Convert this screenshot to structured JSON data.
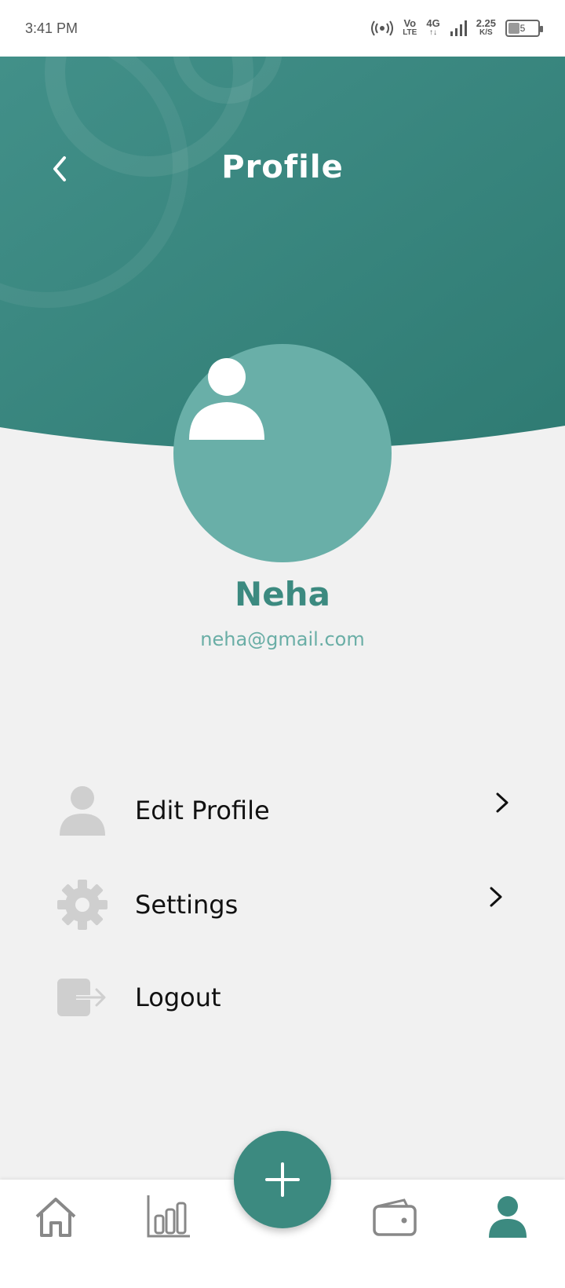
{
  "status_bar": {
    "time": "3:41 PM",
    "network_top": "Vo",
    "network_bottom": "LTE",
    "gen": "4G",
    "speed_value": "2.25",
    "speed_unit": "K/S",
    "battery": "5"
  },
  "header": {
    "title": "Profile",
    "back_icon": "chevron-left-icon",
    "color": "#3c8a80"
  },
  "profile": {
    "avatar_icon": "person-icon",
    "name": "Neha",
    "email": "neha@gmail.com"
  },
  "menu": {
    "items": [
      {
        "label": "Edit Profile",
        "icon": "person-icon"
      },
      {
        "label": "Settings",
        "icon": "gear-icon"
      },
      {
        "label": "Logout",
        "icon": "logout-icon"
      }
    ]
  },
  "bottom_nav": {
    "items": [
      "home-icon",
      "chart-icon",
      "wallet-icon",
      "profile-icon"
    ],
    "fab_icon": "plus-icon",
    "active": "profile-icon"
  }
}
